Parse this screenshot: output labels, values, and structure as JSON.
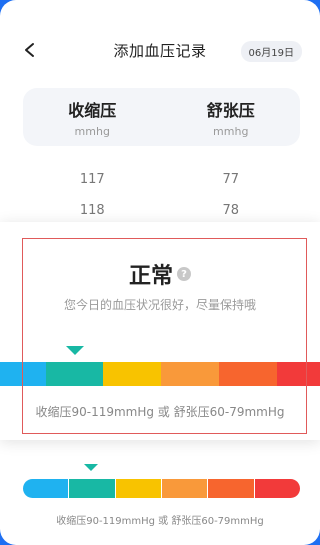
{
  "header": {
    "title": "添加血压记录",
    "date": "06月19日"
  },
  "columns": [
    {
      "title": "收缩压",
      "unit": "mmhg"
    },
    {
      "title": "舒张压",
      "unit": "mmhg"
    }
  ],
  "picker": {
    "rows": [
      {
        "systolic": "117",
        "diastolic": "77"
      },
      {
        "systolic": "118",
        "diastolic": "78"
      }
    ]
  },
  "status": {
    "title": "正常",
    "help_symbol": "?",
    "description": "您今日的血压状况很好，尽量保持哦"
  },
  "scale": {
    "colors": [
      "#1fb2f0",
      "#18b8a4",
      "#f8c300",
      "#f9993a",
      "#f7652e",
      "#f23a3a"
    ],
    "active_index": 1
  },
  "range_text": "收缩压90-119mmHg 或 舒张压60-79mmHg"
}
